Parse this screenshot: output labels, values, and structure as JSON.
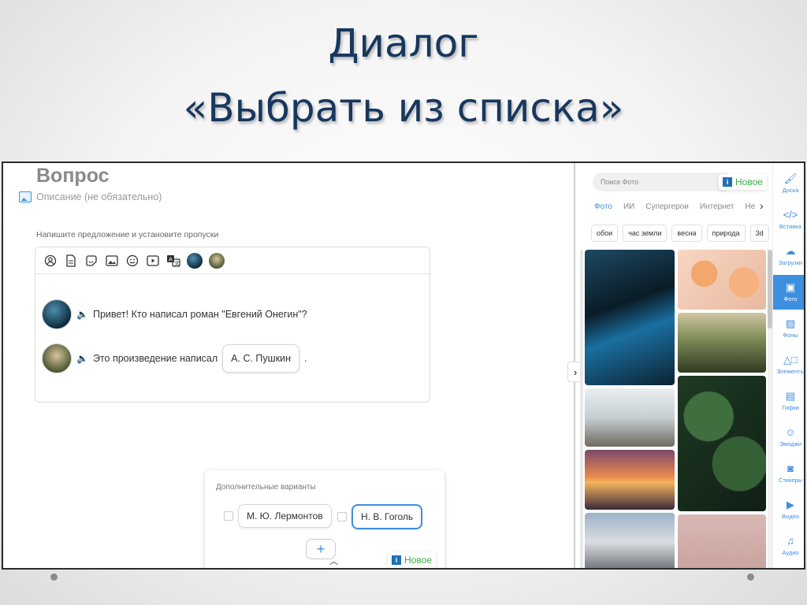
{
  "slide": {
    "title_line1": "Диалог",
    "title_line2": "«Выбрать из списка»"
  },
  "question": {
    "title": "Вопрос",
    "description_placeholder": "Описание (не обязательно)",
    "hint": "Напишите предложение и установите пропуски"
  },
  "editor": {
    "toolbar_icons": [
      "person-icon",
      "document-icon",
      "sticker-icon",
      "image-icon",
      "emoji-icon",
      "video-icon",
      "translate-icon",
      "avatar-cave-icon",
      "avatar-forest-icon"
    ],
    "line1_text": "Привет! Кто написал роман \"Евгений Онегин\"?",
    "line2_text": "Это произведение написал",
    "line2_gap": "А. С. Пушкин",
    "line2_end": "."
  },
  "extra": {
    "title": "Дополнительные варианты",
    "options": [
      "М. Ю. Лермонтов",
      "Н. В. Гоголь"
    ],
    "add_label": "+"
  },
  "badges": {
    "new_label": "Новое",
    "info_label": "i"
  },
  "photo_panel": {
    "search_placeholder": "Поиск Фото",
    "tabs": [
      "Фото",
      "ИИ",
      "Супергерои",
      "Интернет",
      "Не"
    ],
    "tags": [
      "обои",
      "час земли",
      "весна",
      "природа",
      "3d"
    ]
  },
  "sidebar": {
    "items": [
      {
        "label": "Доска",
        "icon": "brush-icon"
      },
      {
        "label": "Вставка",
        "icon": "code-icon"
      },
      {
        "label": "Загрузки",
        "icon": "cloud-upload-icon"
      },
      {
        "label": "Фото",
        "icon": "photo-icon"
      },
      {
        "label": "Фоны",
        "icon": "stripes-icon"
      },
      {
        "label": "Элементы",
        "icon": "shapes-icon"
      },
      {
        "label": "Гифки",
        "icon": "gif-icon"
      },
      {
        "label": "Эмоджи",
        "icon": "emoji-icon"
      },
      {
        "label": "Стикеры",
        "icon": "sticker-icon"
      },
      {
        "label": "Видео",
        "icon": "video-icon"
      },
      {
        "label": "Аудио",
        "icon": "music-icon"
      }
    ]
  },
  "colors": {
    "accent": "#3d8fe0",
    "title_text": "#17375e",
    "new_green": "#3cae45"
  }
}
